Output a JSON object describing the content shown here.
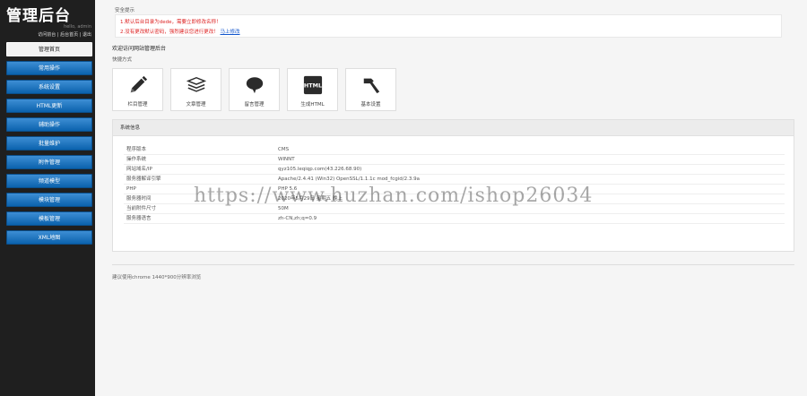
{
  "sidebar": {
    "logo": "管理后台",
    "user": "hello, admin",
    "links": [
      "访问前台",
      "后台首页",
      "退出"
    ],
    "items": [
      {
        "label": "管理首页",
        "active": true
      },
      {
        "label": "常用操作"
      },
      {
        "label": "系统设置"
      },
      {
        "label": "HTML更新"
      },
      {
        "label": "辅助操作"
      },
      {
        "label": "批量维护"
      },
      {
        "label": "附件管理"
      },
      {
        "label": "频道模型"
      },
      {
        "label": "模块管理"
      },
      {
        "label": "模板管理"
      },
      {
        "label": "XML地图"
      }
    ]
  },
  "notice": {
    "title": "安全提示",
    "line1": "1.默认后台目录为dede，需要立即修改名称！",
    "line2": "2.没有更改默认密码，强烈建议您进行更改！",
    "line2_link": "马上修改"
  },
  "welcome": "欢迎访问网站管理后台",
  "quick": {
    "label": "快捷方式",
    "tiles": [
      {
        "label": "栏目管理",
        "icon": "pencil-icon"
      },
      {
        "label": "文章管理",
        "icon": "stack-icon"
      },
      {
        "label": "留言管理",
        "icon": "speech-bubble-icon"
      },
      {
        "label": "生成HTML",
        "icon": "html-icon",
        "badge": "HTML"
      },
      {
        "label": "基本设置",
        "icon": "hammer-icon"
      }
    ]
  },
  "sysinfo": {
    "title": "系统信息",
    "rows": [
      {
        "k": "程序版本",
        "v": "CMS"
      },
      {
        "k": "操作系统",
        "v": "WINNT"
      },
      {
        "k": "网站域名/IP",
        "v": "qyz105.leqiqp.com(43.226.68.90)"
      },
      {
        "k": "服务器解译引擎",
        "v": "Apache/2.4.41 (Win32) OpenSSL/1.1.1c mod_fcgid/2.3.9a"
      },
      {
        "k": "PHP",
        "v": "PHP 5.6"
      },
      {
        "k": "服务器时间",
        "v": "2020年5月29日 星期五 晚上"
      },
      {
        "k": "当前附件尺寸",
        "v": "50M"
      },
      {
        "k": "服务器语言",
        "v": "zh-CN,zh;q=0.9"
      }
    ]
  },
  "footer": "建议使用chrome 1440*900分辨率浏览",
  "watermark": "https://www.huzhan.com/ishop26034",
  "colors": {
    "sidebar_bg": "#1f1f1f",
    "nav_blue": "#1670c0",
    "notice_red": "#dd2222"
  }
}
